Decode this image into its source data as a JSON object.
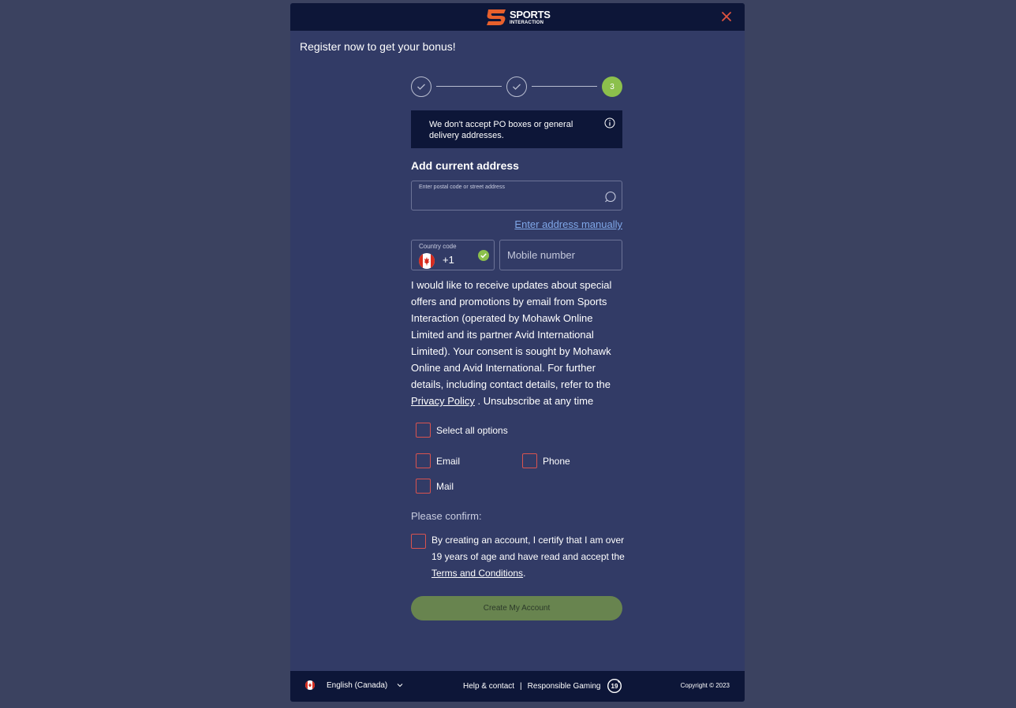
{
  "header": {
    "logo_line1": "SPORTS",
    "logo_line2": "INTERACTION",
    "close_icon": "close-icon"
  },
  "title": "Register now to get your bonus!",
  "stepper": {
    "steps": [
      {
        "state": "done",
        "icon": "check-icon"
      },
      {
        "state": "done",
        "icon": "check-icon"
      },
      {
        "state": "active",
        "label": "3"
      }
    ]
  },
  "notice": {
    "text": "We don't accept PO boxes or general delivery addresses.",
    "icon": "info-icon"
  },
  "address": {
    "heading": "Add current address",
    "field_label": "Enter postal code or street address",
    "value": "",
    "manual_link": "Enter address manually"
  },
  "phone": {
    "country_label": "Country code",
    "country_code": "+1",
    "mobile_placeholder": "Mobile number"
  },
  "consent": {
    "text_before": "I would like to receive updates about special offers and promotions by email from Sports Interaction (operated by Mohawk Online Limited and its partner Avid International Limited). Your consent is sought by Mohawk Online and Avid International. For further details, including contact details, refer to the ",
    "privacy_link": "Privacy Policy",
    "text_after": " . Unsubscribe at any time"
  },
  "options": {
    "select_all": "Select all options",
    "email": "Email",
    "phone": "Phone",
    "mail": "Mail"
  },
  "confirm": {
    "heading": "Please confirm:",
    "text_before": "By creating an account, I certify that I am over 19 years of age and have read and accept the ",
    "terms_link": "Terms and Conditions",
    "text_after": "."
  },
  "create_button": "Create My Account",
  "footer": {
    "language": "English (Canada)",
    "help_link": "Help & contact",
    "separator": "|",
    "responsible_link": "Responsible Gaming",
    "age_badge": "19+",
    "copyright": "Copyright © 2023"
  },
  "colors": {
    "page_bg": "#3b4260",
    "modal_bg": "#323b66",
    "dark_bar": "#0d1638",
    "accent_green": "#8cc04c",
    "checkbox_red": "#d9534f",
    "link_blue": "#7fa7e8",
    "brand_orange": "#e8602c"
  }
}
